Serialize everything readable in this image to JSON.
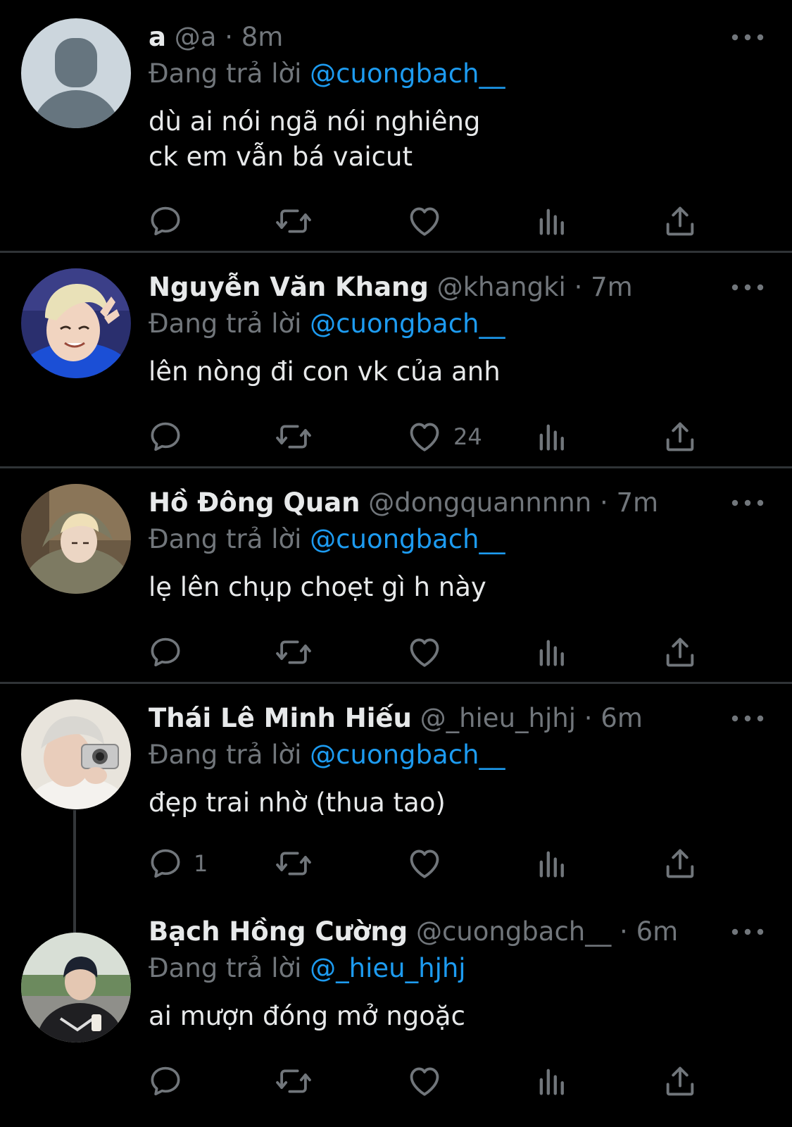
{
  "reply_prefix": "Đang trả lời",
  "colors": {
    "background": "#000000",
    "text": "#e7e9ea",
    "secondary": "#71767b",
    "accent": "#1d9bf0",
    "divider": "#2f3336"
  },
  "tweets": [
    {
      "name": "a",
      "handle": "@a",
      "separator": "·",
      "time": "8m",
      "reply_to": "@cuongbach__",
      "text": "dù ai nói ngã nói nghiêng\nck em vẫn bá vaicut",
      "reply_count": "",
      "retweet_count": "",
      "like_count": "",
      "avatar_icon": "default-avatar-icon"
    },
    {
      "name": "Nguyễn Văn Khang",
      "handle": "@khangki",
      "separator": "·",
      "time": "7m",
      "reply_to": "@cuongbach__",
      "text": "lên nòng đi con vk của anh",
      "reply_count": "",
      "retweet_count": "",
      "like_count": "24",
      "avatar_icon": "profile-photo"
    },
    {
      "name": "Hồ Đông Quan",
      "handle": "@dongquannnnn",
      "separator": "·",
      "time": "7m",
      "reply_to": "@cuongbach__",
      "text": "lẹ lên chụp choẹt gì h này",
      "reply_count": "",
      "retweet_count": "",
      "like_count": "",
      "avatar_icon": "profile-photo"
    },
    {
      "name": "Thái Lê Minh Hiếu",
      "handle": "@_hieu_hjhj",
      "separator": "·",
      "time": "6m",
      "reply_to": "@cuongbach__",
      "text": "đẹp trai nhờ (thua tao)",
      "reply_count": "1",
      "retweet_count": "",
      "like_count": "",
      "avatar_icon": "profile-photo"
    },
    {
      "name": "Bạch Hồng Cường",
      "handle": "@cuongbach__",
      "separator": "·",
      "time": "6m",
      "reply_to": "@_hieu_hjhj",
      "text": "ai mượn đóng mở ngoặc",
      "reply_count": "",
      "retweet_count": "",
      "like_count": "",
      "avatar_icon": "profile-photo"
    }
  ]
}
